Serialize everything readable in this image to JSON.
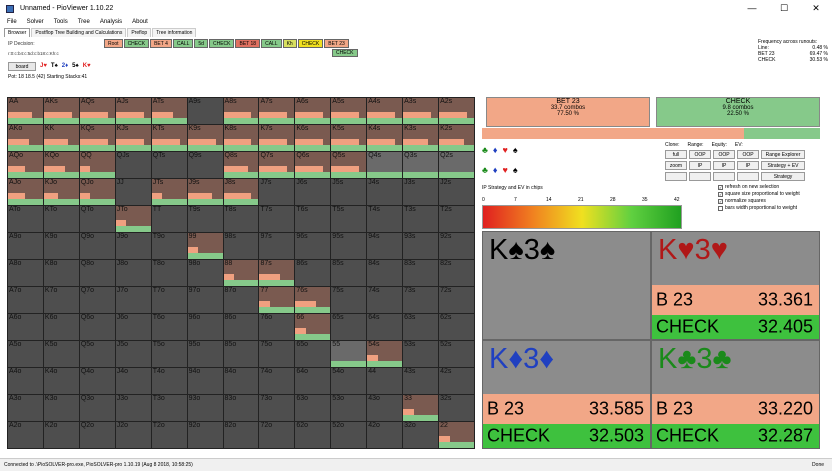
{
  "window": {
    "title": "Unnamed - PioViewer 1.10.22",
    "min": "—",
    "max": "☐",
    "close": "✕"
  },
  "menu": [
    "File",
    "Solver",
    "Tools",
    "Tree",
    "Analysis",
    "About"
  ],
  "tabs": [
    "Browser",
    "Postflop Tree Building and Calculations",
    "Preflop",
    "Tree information"
  ],
  "top": {
    "ip_decision": "IP Decision:",
    "ip_sub": "r:0:c:b4:c:5d:c:b18:c:Kh:c",
    "board_btn": "board",
    "board_cards": [
      {
        "t": "J♥",
        "c": "#e02020"
      },
      {
        "t": "T♠",
        "c": "#000000"
      },
      {
        "t": "2♦",
        "c": "#2040c0"
      },
      {
        "t": "5♠",
        "c": "#000000"
      },
      {
        "t": "K♥",
        "c": "#e02020"
      }
    ],
    "pot": "Pot: 18 18.5 (42) Starting Stacks:41"
  },
  "actions": [
    {
      "label": "Root",
      "bg": "#f2a787"
    },
    {
      "label": "CHECK",
      "bg": "#86c98a"
    },
    {
      "label": "BET 4",
      "bg": "#f2a787"
    },
    {
      "label": "CALL",
      "bg": "#86c98a"
    },
    {
      "label": "5d",
      "bg": "#86c98a"
    },
    {
      "label": "CHECK",
      "bg": "#86c98a"
    },
    {
      "label": "BET 18",
      "bg": "#e07060"
    },
    {
      "label": "CALL",
      "bg": "#86c98a"
    },
    {
      "label": "Kh",
      "bg": "#d8e060"
    },
    {
      "label": "CHECK",
      "bg": "#f0e020"
    },
    {
      "label": "BET 23",
      "bg": "#f2a787"
    }
  ],
  "action_sub": {
    "label": "CHECK",
    "bg": "#86c98a"
  },
  "frequency": {
    "title": "Frequency across runouts:",
    "rows": [
      {
        "k": "Line:",
        "v": "0.48 %"
      },
      {
        "k": "BET 23",
        "v": "69.47 %"
      },
      {
        "k": "CHECK",
        "v": "30.53 %"
      }
    ]
  },
  "matrix": {
    "labels": [
      "AA",
      "AKs",
      "AQs",
      "AJs",
      "ATs",
      "A9s",
      "A8s",
      "A7s",
      "A6s",
      "A5s",
      "A4s",
      "A3s",
      "A2s",
      "AKo",
      "KK",
      "KQs",
      "KJs",
      "KTs",
      "K9s",
      "K8s",
      "K7s",
      "K6s",
      "K5s",
      "K4s",
      "K3s",
      "K2s",
      "AQo",
      "KQo",
      "QQ",
      "QJs",
      "QTs",
      "Q9s",
      "Q8s",
      "Q7s",
      "Q6s",
      "Q5s",
      "Q4s",
      "Q3s",
      "Q2s",
      "AJo",
      "KJo",
      "QJo",
      "JJ",
      "JTs",
      "J9s",
      "J8s",
      "J7s",
      "J6s",
      "J5s",
      "J4s",
      "J3s",
      "J2s",
      "ATo",
      "KTo",
      "QTo",
      "JTo",
      "TT",
      "T9s",
      "T8s",
      "T7s",
      "T6s",
      "T5s",
      "T4s",
      "T3s",
      "T2s",
      "A9o",
      "K9o",
      "Q9o",
      "J9o",
      "T9o",
      "99",
      "98s",
      "97s",
      "96s",
      "95s",
      "94s",
      "93s",
      "92s",
      "A8o",
      "K8o",
      "Q8o",
      "J8o",
      "T8o",
      "98o",
      "88",
      "87s",
      "86s",
      "85s",
      "84s",
      "83s",
      "82s",
      "A7o",
      "K7o",
      "Q7o",
      "J7o",
      "T7o",
      "97o",
      "87o",
      "77",
      "76s",
      "75s",
      "74s",
      "73s",
      "72s",
      "A6o",
      "K6o",
      "Q6o",
      "J6o",
      "T6o",
      "96o",
      "86o",
      "76o",
      "66",
      "65s",
      "64s",
      "63s",
      "62s",
      "A5o",
      "K5o",
      "Q5o",
      "J5o",
      "T5o",
      "95o",
      "85o",
      "75o",
      "65o",
      "55",
      "54s",
      "53s",
      "52s",
      "A4o",
      "K4o",
      "Q4o",
      "J4o",
      "T4o",
      "94o",
      "84o",
      "74o",
      "64o",
      "54o",
      "44",
      "43s",
      "42s",
      "A3o",
      "K3o",
      "Q3o",
      "J3o",
      "T3o",
      "93o",
      "83o",
      "73o",
      "63o",
      "53o",
      "43o",
      "33",
      "32s",
      "A2o",
      "K2o",
      "Q2o",
      "J2o",
      "T2o",
      "92o",
      "82o",
      "72o",
      "62o",
      "52o",
      "42o",
      "32o",
      "22"
    ],
    "bet_freq": [
      0.7,
      0.8,
      0.8,
      0.8,
      0.6,
      0,
      0.8,
      0.8,
      0.8,
      0.8,
      0.8,
      0.8,
      0.8,
      0.6,
      0.7,
      0.8,
      0.8,
      0.8,
      0.8,
      0.8,
      0.8,
      0.8,
      0.8,
      0.8,
      0.7,
      0.7,
      0.5,
      0.6,
      0.3,
      0,
      0,
      0,
      0.7,
      0.8,
      0.8,
      0.8,
      0,
      0,
      0,
      0.5,
      0.4,
      0.3,
      0,
      0.3,
      0.7,
      0.8,
      0,
      0,
      0,
      0,
      0,
      0,
      0,
      0,
      0,
      0.3,
      0,
      0,
      0,
      0,
      0,
      0,
      0,
      0,
      0,
      0,
      0,
      0,
      0,
      0,
      0.3,
      0,
      0,
      0,
      0,
      0,
      0,
      0,
      0,
      0,
      0,
      0,
      0,
      0,
      0.3,
      0.6,
      0,
      0,
      0,
      0,
      0,
      0,
      0,
      0,
      0,
      0,
      0,
      0,
      0.3,
      0.6,
      0,
      0,
      0,
      0,
      0,
      0,
      0,
      0,
      0,
      0,
      0,
      0,
      0.3,
      0,
      0,
      0,
      0,
      0,
      0,
      0,
      0,
      0,
      0,
      0,
      0,
      0,
      0,
      0.3,
      0,
      0,
      0,
      0,
      0,
      0,
      0,
      0,
      0,
      0,
      0,
      0,
      0,
      0,
      0,
      0,
      0,
      0,
      0,
      0,
      0,
      0,
      0,
      0,
      0,
      0,
      0.3,
      0,
      0,
      0,
      0,
      0,
      0,
      0,
      0,
      0,
      0,
      0,
      0,
      0,
      0.3
    ],
    "active": [
      1,
      1,
      1,
      1,
      1,
      0,
      1,
      1,
      1,
      1,
      1,
      1,
      1,
      1,
      1,
      1,
      1,
      1,
      1,
      1,
      1,
      1,
      1,
      1,
      1,
      1,
      1,
      1,
      1,
      0,
      0,
      0,
      1,
      1,
      1,
      1,
      1,
      1,
      1,
      1,
      1,
      1,
      0,
      1,
      1,
      1,
      0,
      0,
      0,
      0,
      0,
      0,
      0,
      0,
      0,
      1,
      0,
      0,
      0,
      0,
      0,
      0,
      0,
      0,
      0,
      0,
      0,
      0,
      0,
      0,
      1,
      0,
      0,
      0,
      0,
      0,
      0,
      0,
      0,
      0,
      0,
      0,
      0,
      0,
      1,
      1,
      0,
      0,
      0,
      0,
      0,
      0,
      0,
      0,
      0,
      0,
      0,
      0,
      1,
      1,
      0,
      0,
      0,
      0,
      0,
      0,
      0,
      0,
      0,
      0,
      0,
      0,
      1,
      0,
      0,
      0,
      0,
      0,
      0,
      0,
      0,
      0,
      0,
      0,
      0,
      0,
      1,
      1,
      0,
      0,
      0,
      0,
      0,
      0,
      0,
      0,
      0,
      0,
      0,
      0,
      0,
      0,
      0,
      0,
      0,
      0,
      0,
      0,
      0,
      0,
      0,
      0,
      0,
      0,
      1,
      0,
      0,
      0,
      0,
      0,
      0,
      0,
      0,
      0,
      0,
      0,
      0,
      0,
      1
    ]
  },
  "summary": {
    "bet": {
      "name": "BET 23",
      "combos": "33.7 combos",
      "pct": "77.50 %"
    },
    "check": {
      "name": "CHECK",
      "combos": "9.8 combos",
      "pct": "22.50 %"
    },
    "bet_fraction": 0.775
  },
  "suits_row1": [
    {
      "t": "♣",
      "c": "#1a8a1a"
    },
    {
      "t": "♦",
      "c": "#2040c0"
    },
    {
      "t": "♥",
      "c": "#e02020"
    },
    {
      "t": "♠",
      "c": "#000"
    }
  ],
  "suits_row2": [
    {
      "t": "♣",
      "c": "#1a8a1a"
    },
    {
      "t": "♦",
      "c": "#2040c0"
    },
    {
      "t": "♥",
      "c": "#e02020"
    },
    {
      "t": "♠",
      "c": "#000"
    }
  ],
  "controls": {
    "labels": [
      "Clone:",
      "Range:",
      "Equity:",
      "EV:"
    ],
    "buttons": [
      "full",
      "OOP",
      "OOP",
      "OOP",
      "Range Explorer",
      "zoom",
      "IP",
      "IP",
      "IP",
      "Strategy + EV",
      "",
      "",
      "",
      "",
      "Strategy"
    ]
  },
  "strategy_label": "IP Strategy and EV in chips",
  "gradient_ticks": [
    "0",
    "7",
    "14",
    "21",
    "28",
    "35",
    "42"
  ],
  "options": [
    {
      "label": "refresh on new selection",
      "checked": true
    },
    {
      "label": "square size proportional to weight",
      "checked": true
    },
    {
      "label": "normalize squares",
      "checked": true
    },
    {
      "label": "bars width proportional to weight",
      "checked": false
    }
  ],
  "combos": [
    {
      "rank1": "K",
      "s1": "♠",
      "rank2": "3",
      "s2": "♠",
      "color": "#000000",
      "bet_label": "",
      "bet_val": "",
      "check_label": "",
      "check_val": "",
      "show_rows": false
    },
    {
      "rank1": "K",
      "s1": "♥",
      "rank2": "3",
      "s2": "♥",
      "color": "#b01818",
      "bet_label": "B 23",
      "bet_val": "33.361",
      "check_label": "CHECK",
      "check_val": "32.405",
      "show_rows": true
    },
    {
      "rank1": "K",
      "s1": "♦",
      "rank2": "3",
      "s2": "♦",
      "color": "#2040c0",
      "bet_label": "B 23",
      "bet_val": "33.585",
      "check_label": "CHECK",
      "check_val": "32.503",
      "show_rows": true
    },
    {
      "rank1": "K",
      "s1": "♣",
      "rank2": "3",
      "s2": "♣",
      "color": "#1a8a1a",
      "bet_label": "B 23",
      "bet_val": "33.220",
      "check_label": "CHECK",
      "check_val": "32.287",
      "show_rows": true
    }
  ],
  "status": {
    "left": "Connected to .\\PioSOLVER-pro.exe, PioSOLVER-pro 1.10.19 (Aug 8 2018, 10:58:25)",
    "right": "Done"
  }
}
